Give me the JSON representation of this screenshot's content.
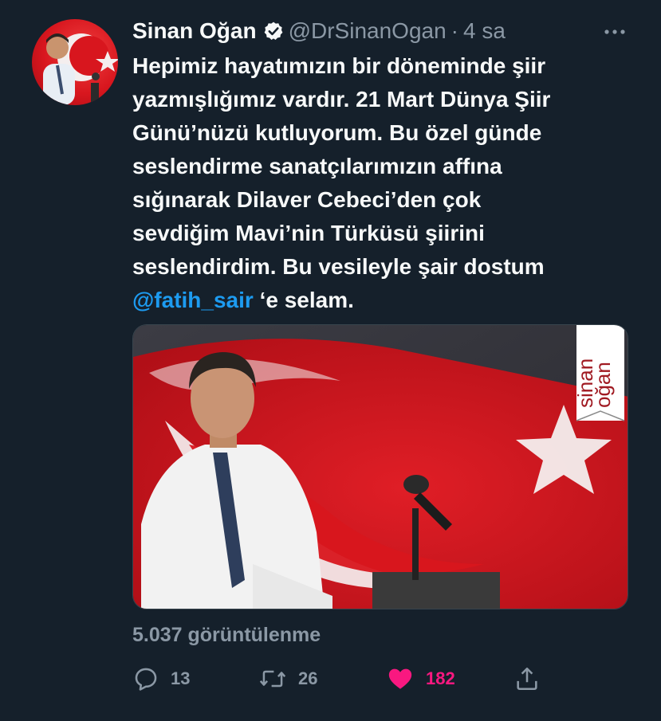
{
  "author": {
    "display_name": "Sinan Oğan",
    "handle": "@DrSinanOgan",
    "separator": "·",
    "time": "4 sa",
    "verified": true
  },
  "tweet": {
    "lines": [
      "Hepimiz hayatımızın bir döneminde şiir",
      "yazmışlığımız vardır. 21 Mart Dünya Şiir",
      "Günü’nüzü kutluyorum. Bu özel günde",
      "seslendirme sanatçılarımızın affına",
      "sığınarak Dilaver Cebeci’den çok",
      "sevdiğim Mavi’nin Türküsü şiirini",
      "seslendirdim. Bu vesileyle şair dostum"
    ],
    "mention": "@fatih_sair",
    "last_line_suffix": " ‘e selam."
  },
  "media": {
    "watermark": "sinan oğan",
    "colors": {
      "flag_red": "#d8161e",
      "flag_white": "#f4eeee"
    }
  },
  "views": "5.037 görüntülenme",
  "actions": {
    "reply_count": "13",
    "retweet_count": "26",
    "like_count": "182",
    "liked": true
  },
  "colors": {
    "background": "#15202b",
    "text": "#f7f9f9",
    "muted": "#8b98a5",
    "link": "#1d9bf0",
    "like": "#f91880"
  },
  "icons": [
    "verified-badge-icon",
    "more-icon",
    "reply-icon",
    "retweet-icon",
    "heart-icon",
    "share-icon"
  ]
}
